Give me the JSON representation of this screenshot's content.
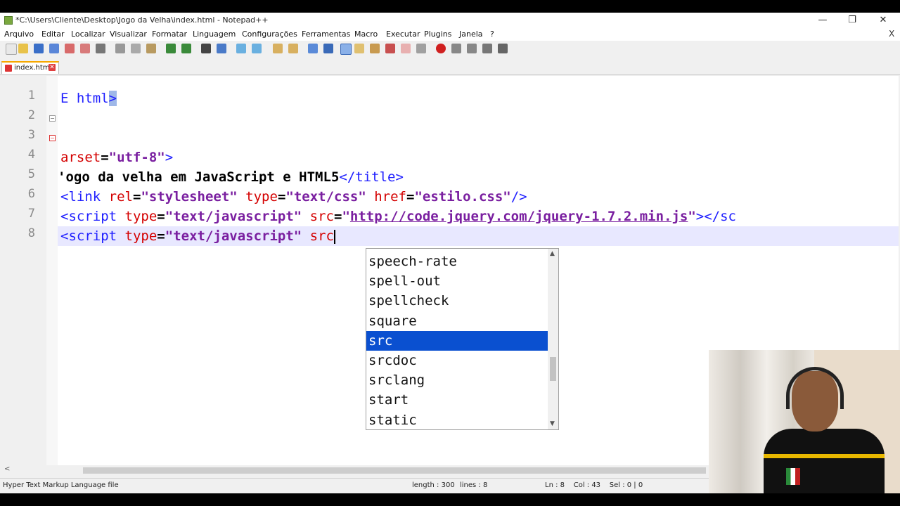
{
  "window": {
    "title": "*C:\\Users\\Cliente\\Desktop\\Jogo da Velha\\index.html - Notepad++",
    "minimize": "—",
    "maximize": "❐",
    "close": "✕"
  },
  "menu": [
    "Arquivo",
    "Editar",
    "Localizar",
    "Visualizar",
    "Formatar",
    "Linguagem",
    "Configurações",
    "Ferramentas",
    "Macro",
    "Executar",
    "Plugins",
    "Janela",
    "?"
  ],
  "menu_close": "X",
  "tab": {
    "label": "index.html",
    "close": "✕"
  },
  "editor": {
    "line_numbers": [
      "1",
      "2",
      "3",
      "4",
      "5",
      "6",
      "7",
      "8"
    ],
    "lines": {
      "l1": {
        "text": "E html",
        "close": ">"
      },
      "l4": {
        "attr": "arset",
        "eq": "=",
        "val": "\"utf-8\"",
        "close": ">"
      },
      "l5": {
        "lead": "'",
        "text": "ogo da velha em JavaScript e HTML5",
        "close": "</title>"
      },
      "l6": {
        "open": "<link",
        "a1": "rel",
        "v1": "\"stylesheet\"",
        "a2": "type",
        "v2": "\"text/css\"",
        "a3": "href",
        "v3": "\"estilo.css\"",
        "close": "/>"
      },
      "l7": {
        "open": "<script",
        "a1": "type",
        "v1": "\"text/javascript\"",
        "a2": "src",
        "v2q": "\"",
        "url": "http://code.jquery.com/jquery-1.7.2.min.js",
        "v2e": "\"",
        "close": "></sc"
      },
      "l8": {
        "open": "<script",
        "a1": "type",
        "v1": "\"text/javascript\"",
        "typed": "src"
      }
    }
  },
  "autocomplete": {
    "options": [
      "speech-rate",
      "spell-out",
      "spellcheck",
      "square",
      "src",
      "srcdoc",
      "srclang",
      "start",
      "static"
    ],
    "selected_index": 4,
    "up": "▲",
    "down": "▼"
  },
  "status": {
    "file_type": "Hyper Text Markup Language file",
    "length": "length : 300",
    "lines": "lines : 8",
    "position": "Ln : 8    Col : 43    Sel : 0 | 0"
  },
  "hscroll_left": "<",
  "colors": {
    "selection": "#0a50d0",
    "tag": "#2020ff",
    "attr": "#d40000",
    "value": "#7a1fa0"
  }
}
